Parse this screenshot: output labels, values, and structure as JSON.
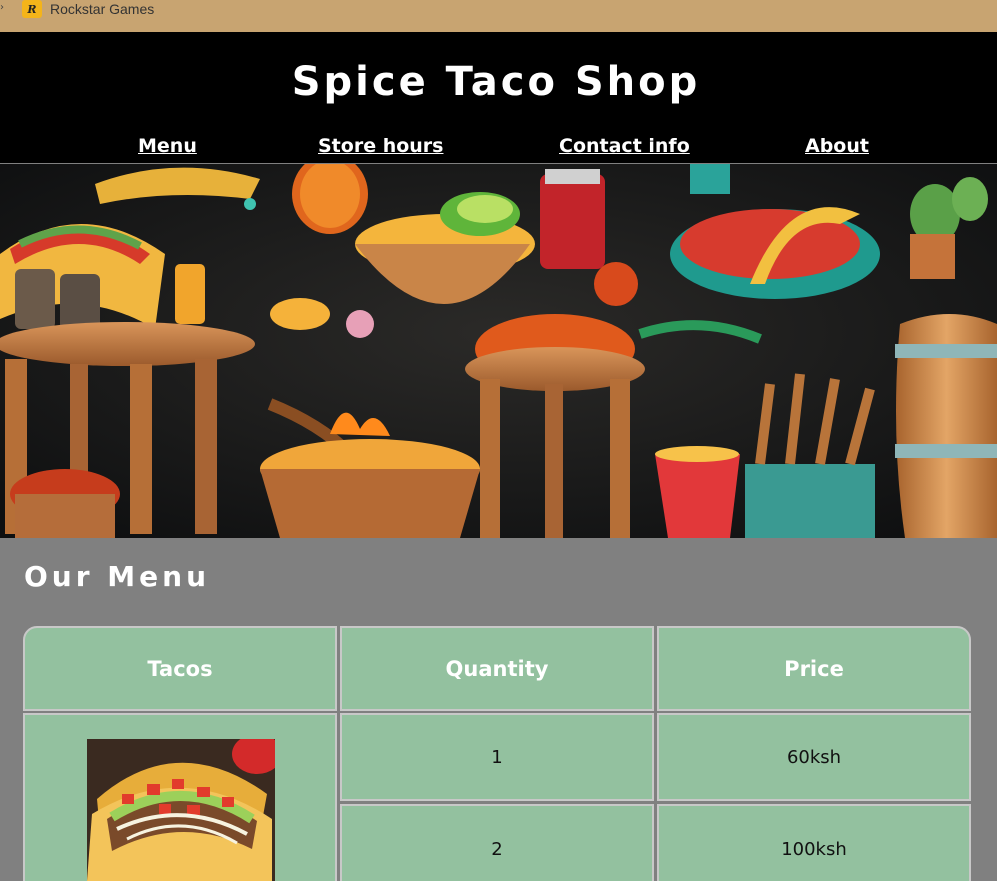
{
  "browser": {
    "bookmark_label": "Rockstar Games",
    "bookmark_icon": "rockstar-games-icon",
    "bookmark_icon_text": "R"
  },
  "header": {
    "title": "Spice Taco Shop",
    "nav": [
      "Menu",
      "Store hours",
      "Contact info",
      "About"
    ]
  },
  "menu": {
    "title": "Our Menu",
    "columns": [
      "Tacos",
      "Quantity",
      "Price"
    ],
    "rows": [
      {
        "quantity": "1",
        "price": "60ksh"
      },
      {
        "quantity": "2",
        "price": "100ksh"
      }
    ]
  },
  "colors": {
    "bookmark_bar": "#c8a471",
    "header_bg": "#000000",
    "page_bg": "#808080",
    "table_cell": "#93c19f",
    "cell_border": "#c8c8c8",
    "text_light": "#ffffff"
  }
}
